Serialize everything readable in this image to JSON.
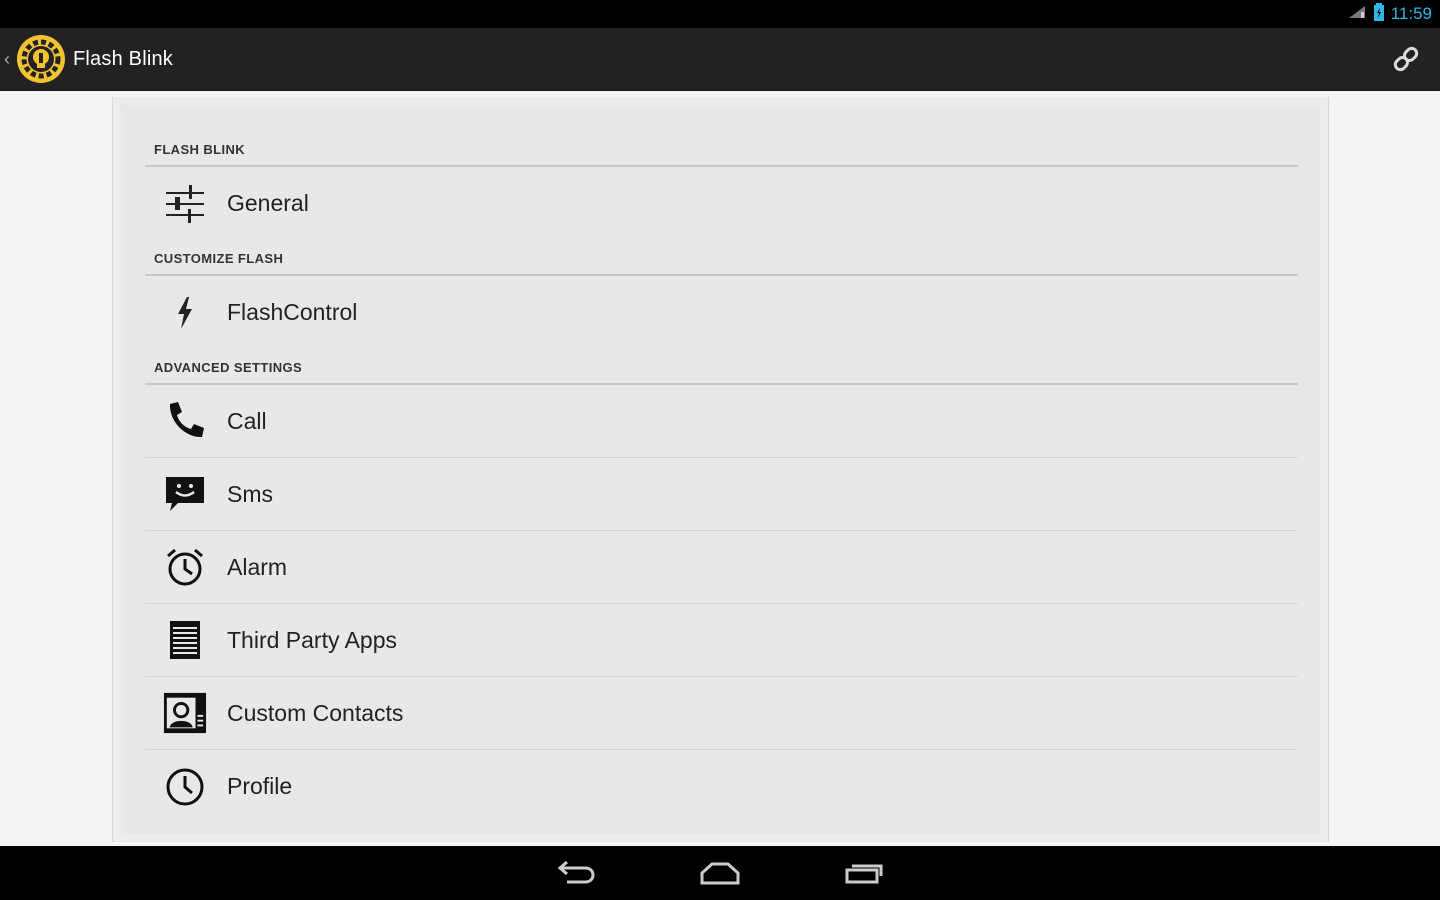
{
  "status_bar": {
    "time": "11:59",
    "signal_icon": "signal-icon",
    "battery_icon": "battery-icon",
    "accent_color": "#33b5e5"
  },
  "action_bar": {
    "up_icon": "chevron-left-icon",
    "logo_icon": "gear-bulb-logo-icon",
    "title": "Flash Blink",
    "action_icon": "link-icon"
  },
  "sections": [
    {
      "header": "FLASH BLINK",
      "items": [
        {
          "label": "General",
          "icon": "sliders-icon"
        }
      ]
    },
    {
      "header": "CUSTOMIZE FLASH",
      "items": [
        {
          "label": "FlashControl",
          "icon": "lightning-icon"
        }
      ]
    },
    {
      "header": "ADVANCED SETTINGS",
      "items": [
        {
          "label": "Call",
          "icon": "phone-icon"
        },
        {
          "label": "Sms",
          "icon": "message-icon"
        },
        {
          "label": "Alarm",
          "icon": "alarm-clock-icon"
        },
        {
          "label": "Third Party Apps",
          "icon": "list-icon"
        },
        {
          "label": "Custom Contacts",
          "icon": "contact-card-icon"
        },
        {
          "label": "Profile",
          "icon": "clock-icon"
        }
      ]
    }
  ],
  "nav_bar": {
    "back_icon": "back-icon",
    "home_icon": "home-icon",
    "recents_icon": "recents-icon"
  }
}
